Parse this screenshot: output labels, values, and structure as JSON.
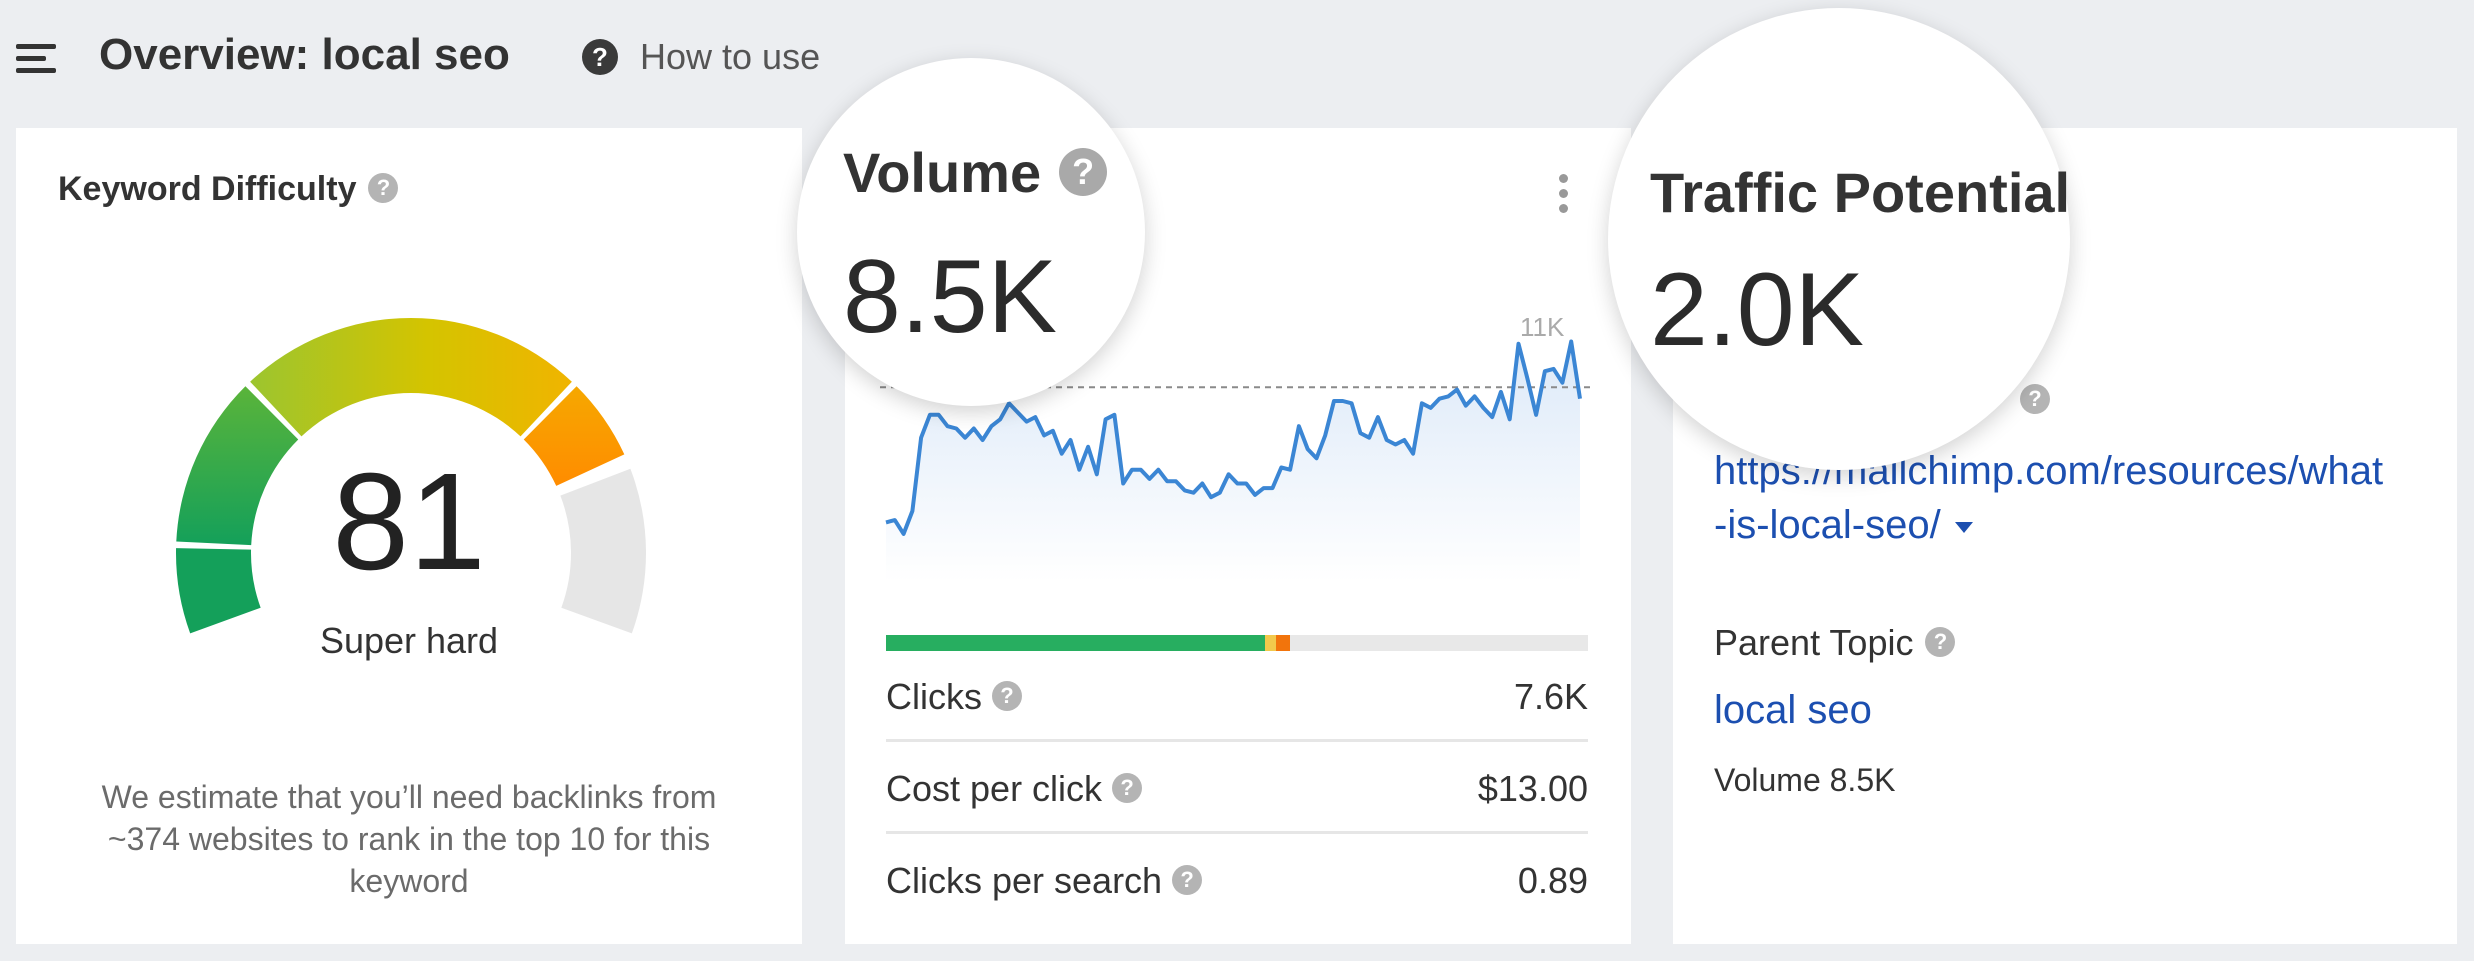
{
  "header": {
    "title": "Overview: local seo",
    "help_symbol": "?",
    "how_to_use": "How to use",
    "menu_icon": "hamburger-menu-icon"
  },
  "keyword_difficulty": {
    "title": "Keyword Difficulty",
    "help_symbol": "?",
    "score": "81",
    "score_value": 81,
    "label": "Super hard",
    "description": "We estimate that you’ll need backlinks from ~374 websites to rank in the top 10 for this keyword",
    "colors": {
      "green_dark": "#14a05a",
      "green": "#5ab43a",
      "yellow": "#d4c400",
      "orange": "#f4a000",
      "empty": "#e6e6e6"
    }
  },
  "volume": {
    "title": "Volume",
    "help_symbol": "?",
    "value": "8.5K",
    "chart_max_label": "11K",
    "clicks_bar": {
      "organic_pct": 54,
      "yellow_pct": 1.5,
      "orange_pct": 2
    },
    "metrics": [
      {
        "label": "Clicks",
        "value": "7.6K"
      },
      {
        "label": "Cost per click",
        "value": "$13.00"
      },
      {
        "label": "Clicks per search",
        "value": "0.89"
      }
    ],
    "colors": {
      "line": "#3b86d4",
      "area": "#dce9f8",
      "organic": "#27ae60",
      "paid_yellow": "#f2c94c",
      "paid_orange": "#f2740c"
    }
  },
  "traffic_potential": {
    "title": "Traffic Potential",
    "value": "2.0K",
    "help_symbol": "?",
    "url_line1": "https://mailchimp.com/resources/what",
    "url_line2": "-is-local-seo/",
    "parent_topic_label": "Parent Topic",
    "parent_topic_help": "?",
    "parent_topic_link": "local seo",
    "parent_volume": "Volume 8.5K"
  },
  "chart_data": {
    "type": "area",
    "title": "",
    "ylim": [
      0,
      11000
    ],
    "y_tick_labels": [
      "11K"
    ],
    "reference_line": 8500,
    "values": [
      2600,
      2700,
      2100,
      3100,
      6300,
      7300,
      7300,
      6800,
      6700,
      6300,
      6700,
      6200,
      6800,
      7100,
      7800,
      7400,
      7000,
      7200,
      6400,
      6600,
      5600,
      6200,
      4900,
      5900,
      4700,
      7100,
      7300,
      4300,
      4900,
      4900,
      4500,
      4900,
      4400,
      4400,
      4000,
      3900,
      4300,
      3700,
      3900,
      4700,
      4300,
      4300,
      3800,
      4100,
      4100,
      5000,
      4900,
      6800,
      5800,
      5400,
      6400,
      7900,
      7900,
      7800,
      6500,
      6300,
      7200,
      6200,
      6000,
      6200,
      5600,
      7800,
      7600,
      8000,
      8100,
      8400,
      7700,
      8100,
      7600,
      7200,
      8300,
      7100,
      10400,
      8900,
      7300,
      9200,
      9300,
      8700,
      10500,
      8000
    ]
  }
}
